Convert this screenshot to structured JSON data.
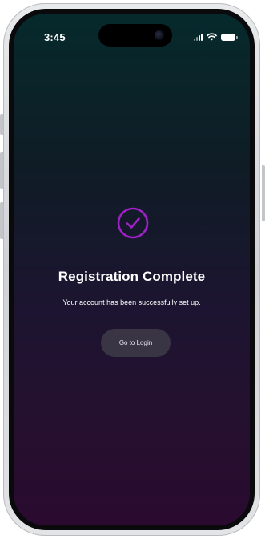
{
  "status_bar": {
    "time": "3:45",
    "icons": [
      "cellular-signal-icon",
      "wifi-icon",
      "battery-icon"
    ]
  },
  "main": {
    "icon": "check-circle-icon",
    "title": "Registration Complete",
    "subtitle": "Your account has been successfully set up.",
    "primary_button_label": "Go to Login"
  },
  "colors": {
    "accent": "#a020c8",
    "gradient_top": "#062a2c",
    "gradient_bottom": "#2a0a2f",
    "button_bg": "#3a3545"
  }
}
